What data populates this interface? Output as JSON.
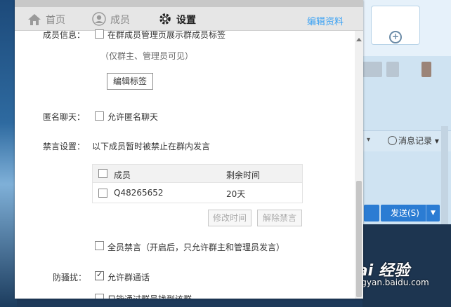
{
  "nav": {
    "home_label": "首页",
    "members_label": "成员",
    "settings_label": "设置",
    "edit_profile_label": "编辑资料"
  },
  "member_info": {
    "label": "成员信息：",
    "show_tag_checkbox_label": "在群成员管理页展示群成员标签",
    "show_tag_checked": false,
    "visibility_note": "（仅群主、管理员可见）",
    "edit_tags_button": "编辑标签"
  },
  "anonymous_chat": {
    "label": "匿名聊天：",
    "allow_checkbox_label": "允许匿名聊天",
    "checked": false
  },
  "mute_settings": {
    "label": "禁言设置：",
    "description": "以下成员暂时被禁止在群内发言",
    "table_headers": {
      "member": "成员",
      "remaining": "剩余时间"
    },
    "rows": [
      {
        "member": "Q48265652",
        "remaining": "20天",
        "checked": false
      }
    ],
    "modify_time_button": "修改时间",
    "unmute_button": "解除禁言",
    "mute_all_label": "全员禁言（开启后，只允许群主和管理员发言）",
    "mute_all_checked": false
  },
  "anti_harassment": {
    "label": "防骚扰：",
    "allow_call_label": "允许群通话",
    "allow_call_checked": true,
    "search_join_label": "只能通过群号找到该群"
  },
  "background": {
    "history_label": "消息记录",
    "send_label": "发送(S)"
  },
  "watermark": {
    "brand": "Bai 经验",
    "url": "jingyan.baidu.com"
  },
  "colors": {
    "accent_link": "#3aa1f3",
    "nav_bg": "#e6e6e6",
    "send_button": "#2b7cd3"
  }
}
